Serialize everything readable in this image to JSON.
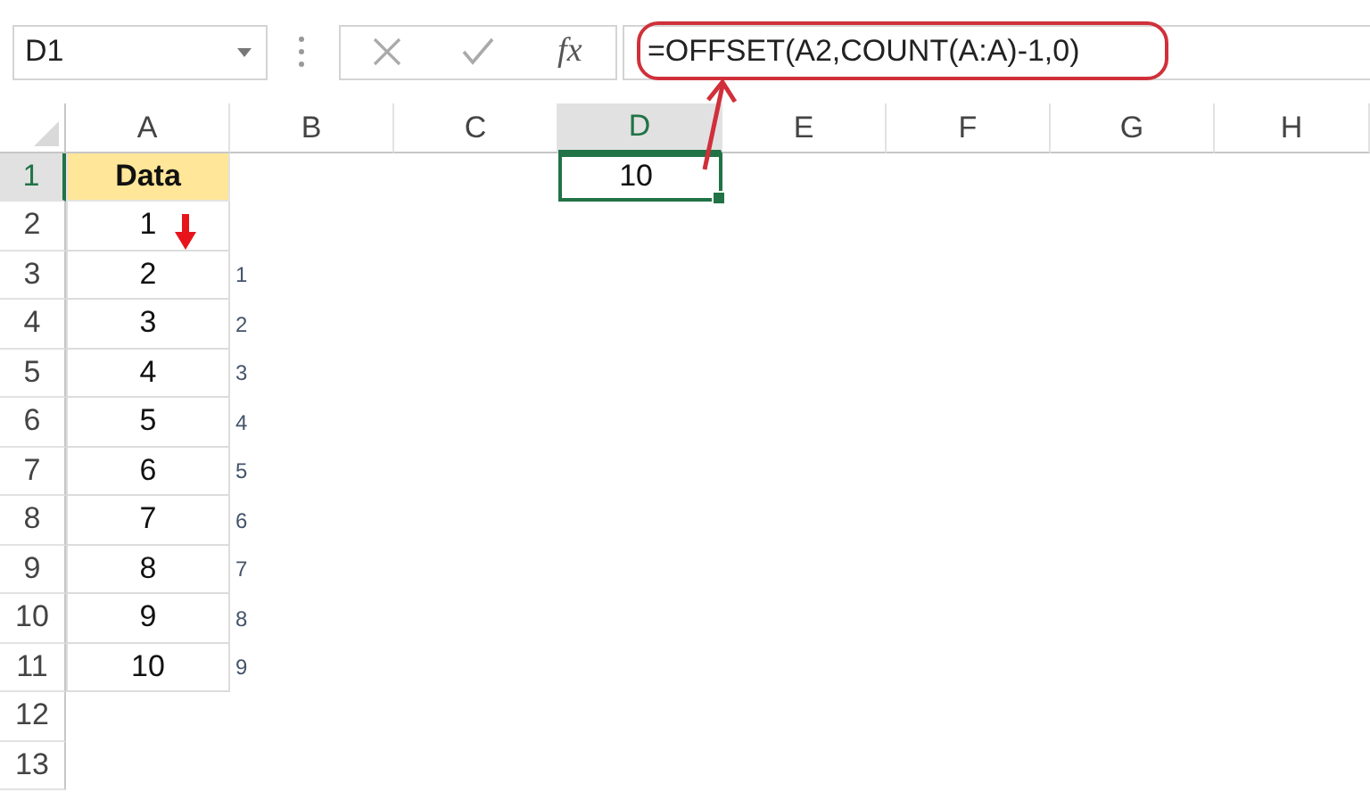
{
  "name_box": {
    "value": "D1"
  },
  "formula_bar": {
    "function_label": "fx",
    "formula": "=OFFSET(A2,COUNT(A:A)-1,0)"
  },
  "columns": [
    {
      "label": "A",
      "selected": false
    },
    {
      "label": "B",
      "selected": false
    },
    {
      "label": "C",
      "selected": false
    },
    {
      "label": "D",
      "selected": true
    },
    {
      "label": "E",
      "selected": false
    },
    {
      "label": "F",
      "selected": false
    },
    {
      "label": "G",
      "selected": false
    },
    {
      "label": "H",
      "selected": false
    }
  ],
  "rows": [
    {
      "label": "1",
      "selected": true,
      "cells": [
        {
          "value": "Data",
          "kind": "header"
        },
        null,
        null,
        {
          "value": "10",
          "kind": "number",
          "selected": true
        },
        null,
        null,
        null,
        null
      ]
    },
    {
      "label": "2",
      "selected": false,
      "cells": [
        {
          "value": "1",
          "kind": "data"
        },
        null,
        null,
        null,
        null,
        null,
        null,
        null
      ]
    },
    {
      "label": "3",
      "selected": false,
      "cells": [
        {
          "value": "2",
          "kind": "data"
        },
        {
          "value": "1",
          "kind": "note"
        },
        null,
        null,
        null,
        null,
        null,
        null
      ]
    },
    {
      "label": "4",
      "selected": false,
      "cells": [
        {
          "value": "3",
          "kind": "data"
        },
        {
          "value": "2",
          "kind": "note"
        },
        null,
        null,
        null,
        null,
        null,
        null
      ]
    },
    {
      "label": "5",
      "selected": false,
      "cells": [
        {
          "value": "4",
          "kind": "data"
        },
        {
          "value": "3",
          "kind": "note"
        },
        null,
        null,
        null,
        null,
        null,
        null
      ]
    },
    {
      "label": "6",
      "selected": false,
      "cells": [
        {
          "value": "5",
          "kind": "data"
        },
        {
          "value": "4",
          "kind": "note"
        },
        null,
        null,
        null,
        null,
        null,
        null
      ]
    },
    {
      "label": "7",
      "selected": false,
      "cells": [
        {
          "value": "6",
          "kind": "data"
        },
        {
          "value": "5",
          "kind": "note"
        },
        null,
        null,
        null,
        null,
        null,
        null
      ]
    },
    {
      "label": "8",
      "selected": false,
      "cells": [
        {
          "value": "7",
          "kind": "data"
        },
        {
          "value": "6",
          "kind": "note"
        },
        null,
        null,
        null,
        null,
        null,
        null
      ]
    },
    {
      "label": "9",
      "selected": false,
      "cells": [
        {
          "value": "8",
          "kind": "data"
        },
        {
          "value": "7",
          "kind": "note"
        },
        null,
        null,
        null,
        null,
        null,
        null
      ]
    },
    {
      "label": "10",
      "selected": false,
      "cells": [
        {
          "value": "9",
          "kind": "data"
        },
        {
          "value": "8",
          "kind": "note"
        },
        null,
        null,
        null,
        null,
        null,
        null
      ]
    },
    {
      "label": "11",
      "selected": false,
      "cells": [
        {
          "value": "10",
          "kind": "data"
        },
        {
          "value": "9",
          "kind": "note"
        },
        null,
        null,
        null,
        null,
        null,
        null
      ]
    },
    {
      "label": "12",
      "selected": false,
      "cells": [
        null,
        null,
        null,
        null,
        null,
        null,
        null,
        null
      ]
    },
    {
      "label": "13",
      "selected": false,
      "cells": [
        null,
        null,
        null,
        null,
        null,
        null,
        null,
        null
      ]
    }
  ]
}
